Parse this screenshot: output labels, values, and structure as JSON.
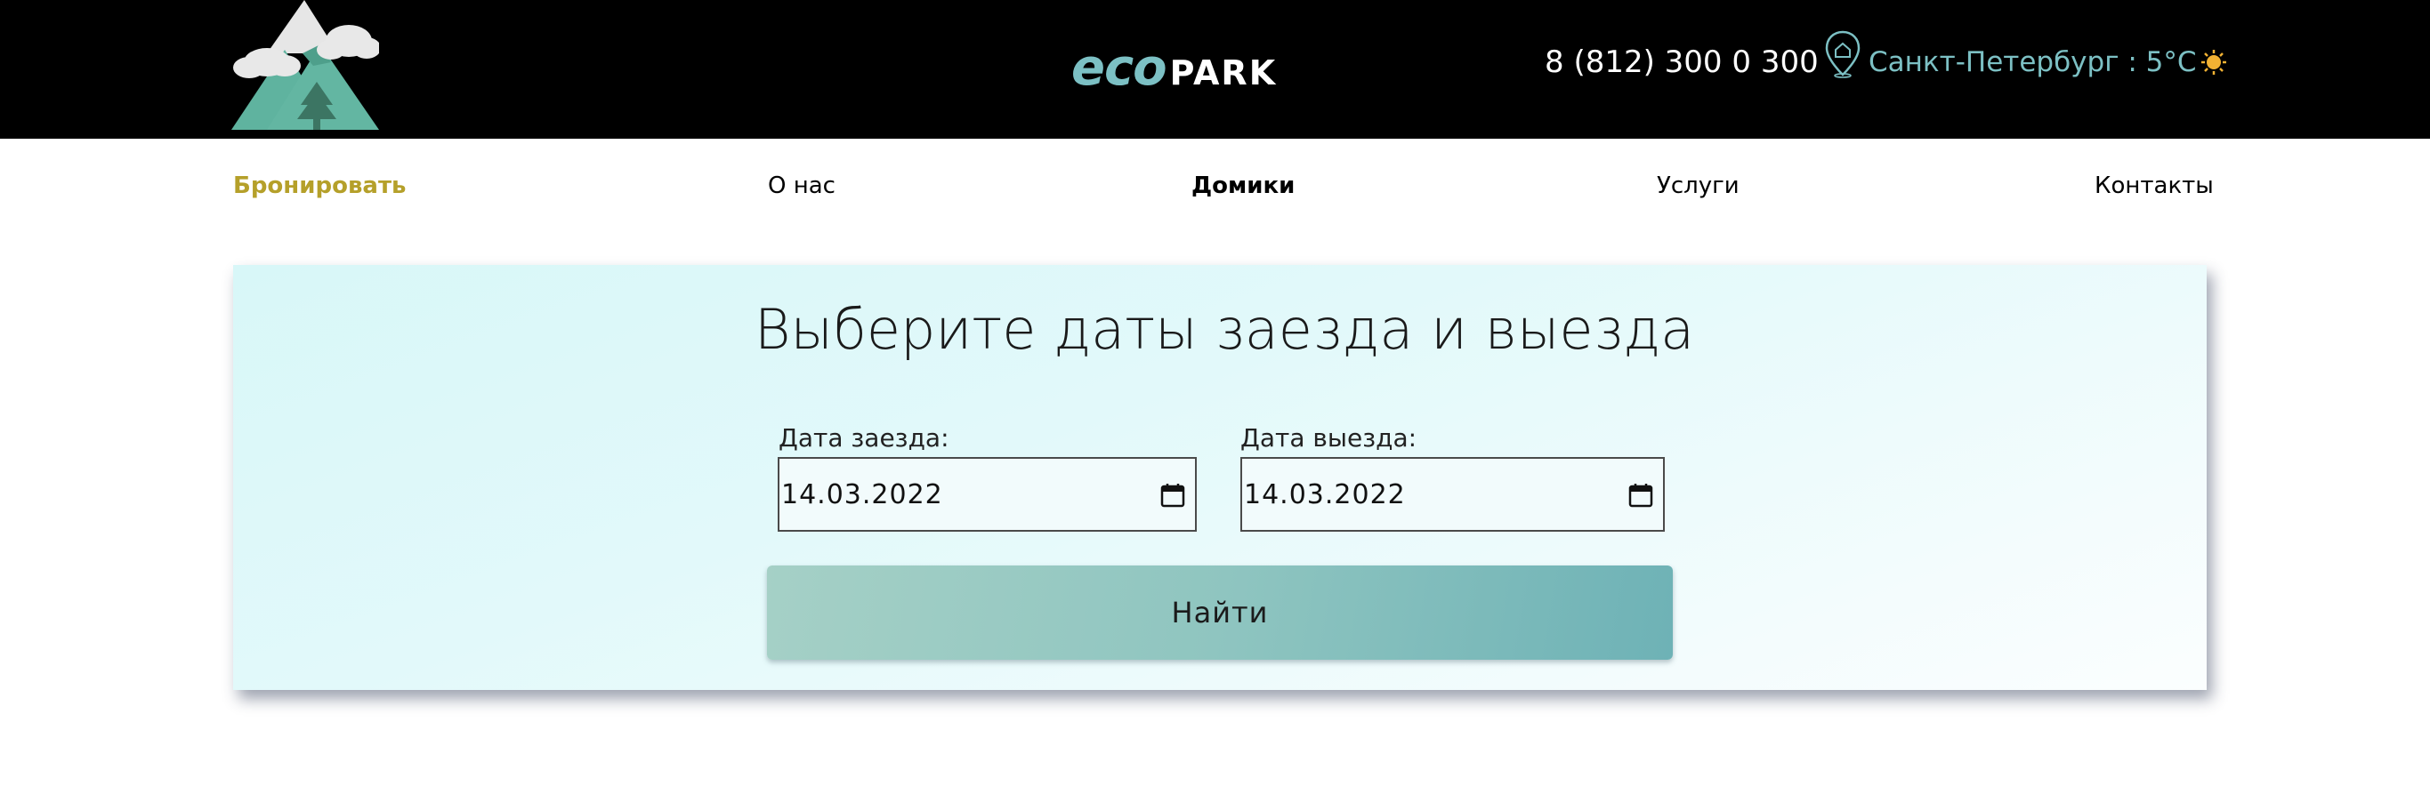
{
  "header": {
    "brand_eco": "eco",
    "brand_park": "PARK",
    "phone": "8 (812) 300 0 300",
    "city_weather": "Санкт-Петербург : 5°С",
    "icons": [
      "mountain-logo-icon",
      "location-pin-icon",
      "sun-icon"
    ],
    "accent_color": "#7cc0c4"
  },
  "nav": {
    "book": "Бронировать",
    "about": "О нас",
    "houses": "Домики",
    "services": "Услуги",
    "contacts": "Контакты",
    "book_color": "#b5a02a"
  },
  "booking": {
    "title": "Выберите даты заезда и выезда",
    "checkin_label": "Дата заезда:",
    "checkin_value": "14.03.2022",
    "checkout_label": "Дата выезда:",
    "checkout_value": "14.03.2022",
    "search_button": "Найти",
    "icons": [
      "calendar-icon"
    ]
  }
}
